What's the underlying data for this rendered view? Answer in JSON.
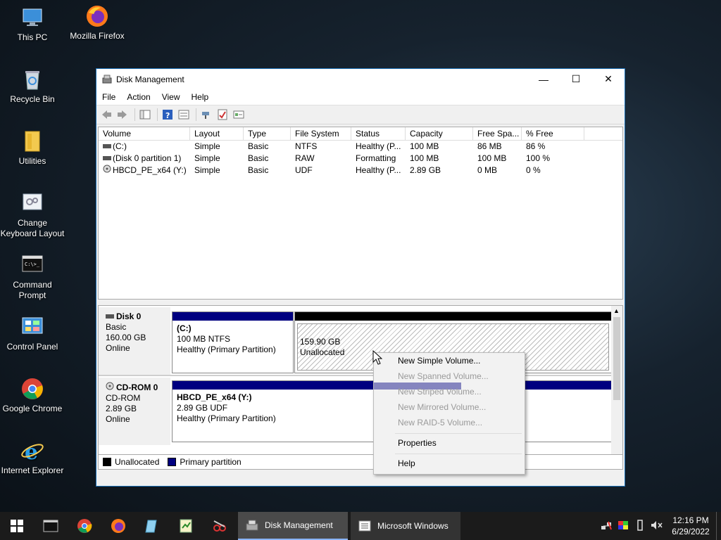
{
  "desktop": {
    "icons": [
      {
        "label": "This PC"
      },
      {
        "label": "Mozilla Firefox"
      },
      {
        "label": "Recycle Bin"
      },
      {
        "label": "Utilities"
      },
      {
        "label": "Change Keyboard Layout"
      },
      {
        "label": "Command Prompt"
      },
      {
        "label": "Control Panel"
      },
      {
        "label": "Google Chrome"
      },
      {
        "label": "Internet Explorer"
      }
    ]
  },
  "window": {
    "title": "Disk Management",
    "menu": [
      "File",
      "Action",
      "View",
      "Help"
    ]
  },
  "volumes": {
    "columns": [
      "Volume",
      "Layout",
      "Type",
      "File System",
      "Status",
      "Capacity",
      "Free Spa...",
      "% Free"
    ],
    "rows": [
      [
        "(C:)",
        "Simple",
        "Basic",
        "NTFS",
        "Healthy (P...",
        "100 MB",
        "86 MB",
        "86 %"
      ],
      [
        "(Disk 0 partition 1)",
        "Simple",
        "Basic",
        "RAW",
        "Formatting",
        "100 MB",
        "100 MB",
        "100 %"
      ],
      [
        "HBCD_PE_x64 (Y:)",
        "Simple",
        "Basic",
        "UDF",
        "Healthy (P...",
        "2.89 GB",
        "0 MB",
        "0 %"
      ]
    ]
  },
  "disks": {
    "disk0": {
      "name": "Disk 0",
      "type": "Basic",
      "size": "160.00 GB",
      "state": "Online",
      "p1": {
        "title": "(C:)",
        "line2": "100 MB NTFS",
        "line3": "Healthy (Primary Partition)"
      },
      "p2": {
        "line1": "159.90 GB",
        "line2": "Unallocated"
      }
    },
    "cdrom0": {
      "name": "CD-ROM 0",
      "type": "CD-ROM",
      "size": "2.89 GB",
      "state": "Online",
      "p1": {
        "title": "HBCD_PE_x64  (Y:)",
        "line2": "2.89 GB UDF",
        "line3": "Healthy (Primary Partition)"
      }
    }
  },
  "legend": {
    "unallocated": "Unallocated",
    "primary": "Primary partition"
  },
  "colors": {
    "primary": "#000080",
    "unallocated": "#000000",
    "accent": "#1a6fb5"
  },
  "context_menu": {
    "new_simple": "New Simple Volume...",
    "new_spanned": "New Spanned Volume...",
    "new_striped": "New Striped Volume...",
    "new_mirrored": "New Mirrored Volume...",
    "new_raid5": "New RAID-5 Volume...",
    "properties": "Properties",
    "help": "Help"
  },
  "taskbar": {
    "tasks": [
      "Disk Management",
      "Microsoft Windows"
    ],
    "time": "12:16 PM",
    "date": "6/29/2022"
  }
}
